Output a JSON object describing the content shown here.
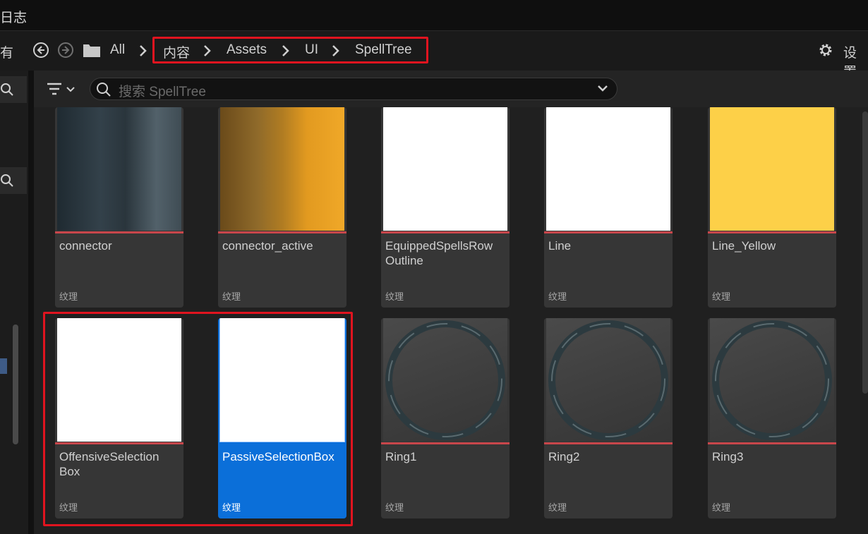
{
  "topbar": {
    "title": "日志"
  },
  "navbar": {
    "left_label": "有",
    "back_icon": "back-circle-icon",
    "forward_icon": "forward-circle-icon",
    "folder_icon": "folder-icon",
    "root_label": "All",
    "breadcrumbs": [
      "内容",
      "Assets",
      "UI",
      "SpellTree"
    ],
    "settings_label": "设置"
  },
  "search": {
    "placeholder": "搜索 SpellTree"
  },
  "assets": [
    {
      "name": "connector",
      "type": "纹理",
      "thumb": "dark-metal"
    },
    {
      "name": "connector_active",
      "type": "纹理",
      "thumb": "orange-metal"
    },
    {
      "name": "EquippedSpellsRow Outline",
      "type": "纹理",
      "thumb": "white"
    },
    {
      "name": "Line",
      "type": "纹理",
      "thumb": "white"
    },
    {
      "name": "Line_Yellow",
      "type": "纹理",
      "thumb": "yellow"
    },
    {
      "name": "OffensiveSelection Box",
      "type": "纹理",
      "thumb": "white"
    },
    {
      "name": "PassiveSelectionBox",
      "type": "纹理",
      "thumb": "white",
      "selected": true
    },
    {
      "name": "Ring1",
      "type": "纹理",
      "thumb": "ring"
    },
    {
      "name": "Ring2",
      "type": "纹理",
      "thumb": "ring"
    },
    {
      "name": "Ring3",
      "type": "纹理",
      "thumb": "ring"
    }
  ],
  "colors": {
    "highlight_box": "#e0141f",
    "selected": "#0b6fd9",
    "texture_bar": "#c8464b",
    "yellow": "#fdd048"
  }
}
